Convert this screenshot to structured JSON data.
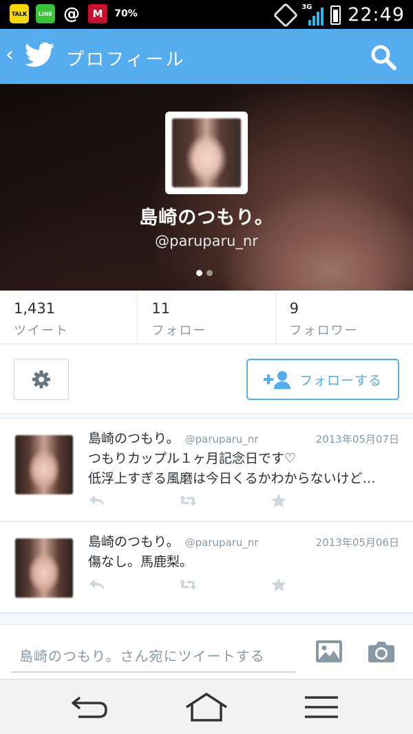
{
  "status_bar": {
    "apps": [
      "TALK",
      "LINE",
      "@",
      "M",
      "70%"
    ],
    "network": "3G",
    "time": "22:49"
  },
  "app_bar": {
    "back_icon": "chevron-left-icon",
    "logo_icon": "twitter-bird-icon",
    "title": "プロフィール",
    "search_icon": "search-icon",
    "accent_color": "#55acee"
  },
  "profile": {
    "name": "島崎のつもり。",
    "handle": "@paruparu_nr",
    "carousel_pages": 2,
    "carousel_active": 1
  },
  "stats": [
    {
      "count": "1,431",
      "label": "ツイート"
    },
    {
      "count": "11",
      "label": "フォロー"
    },
    {
      "count": "9",
      "label": "フォロワー"
    }
  ],
  "actions": {
    "settings_icon": "gear-icon",
    "follow_label": "フォローする",
    "follow_icon": "add-user-icon"
  },
  "tweets": [
    {
      "name": "島崎のつもり。",
      "handle": "@paruparu_nr",
      "date": "2013年05月07日",
      "line1": "つもりカップル１ヶ月記念日です♡",
      "line2": "低浮上すぎる風磨は今日くるかわからないけど…"
    },
    {
      "name": "島崎のつもり。",
      "handle": "@paruparu_nr",
      "date": "2013年05月06日",
      "line1": "傷なし。馬鹿梨。",
      "line2": ""
    }
  ],
  "composer": {
    "placeholder": "島崎のつもり。さん宛にツイートする",
    "image_icon": "image-icon",
    "camera_icon": "camera-icon"
  },
  "nav_bar": {
    "back_icon": "nav-back-icon",
    "home_icon": "home-icon",
    "menu_icon": "menu-icon"
  }
}
